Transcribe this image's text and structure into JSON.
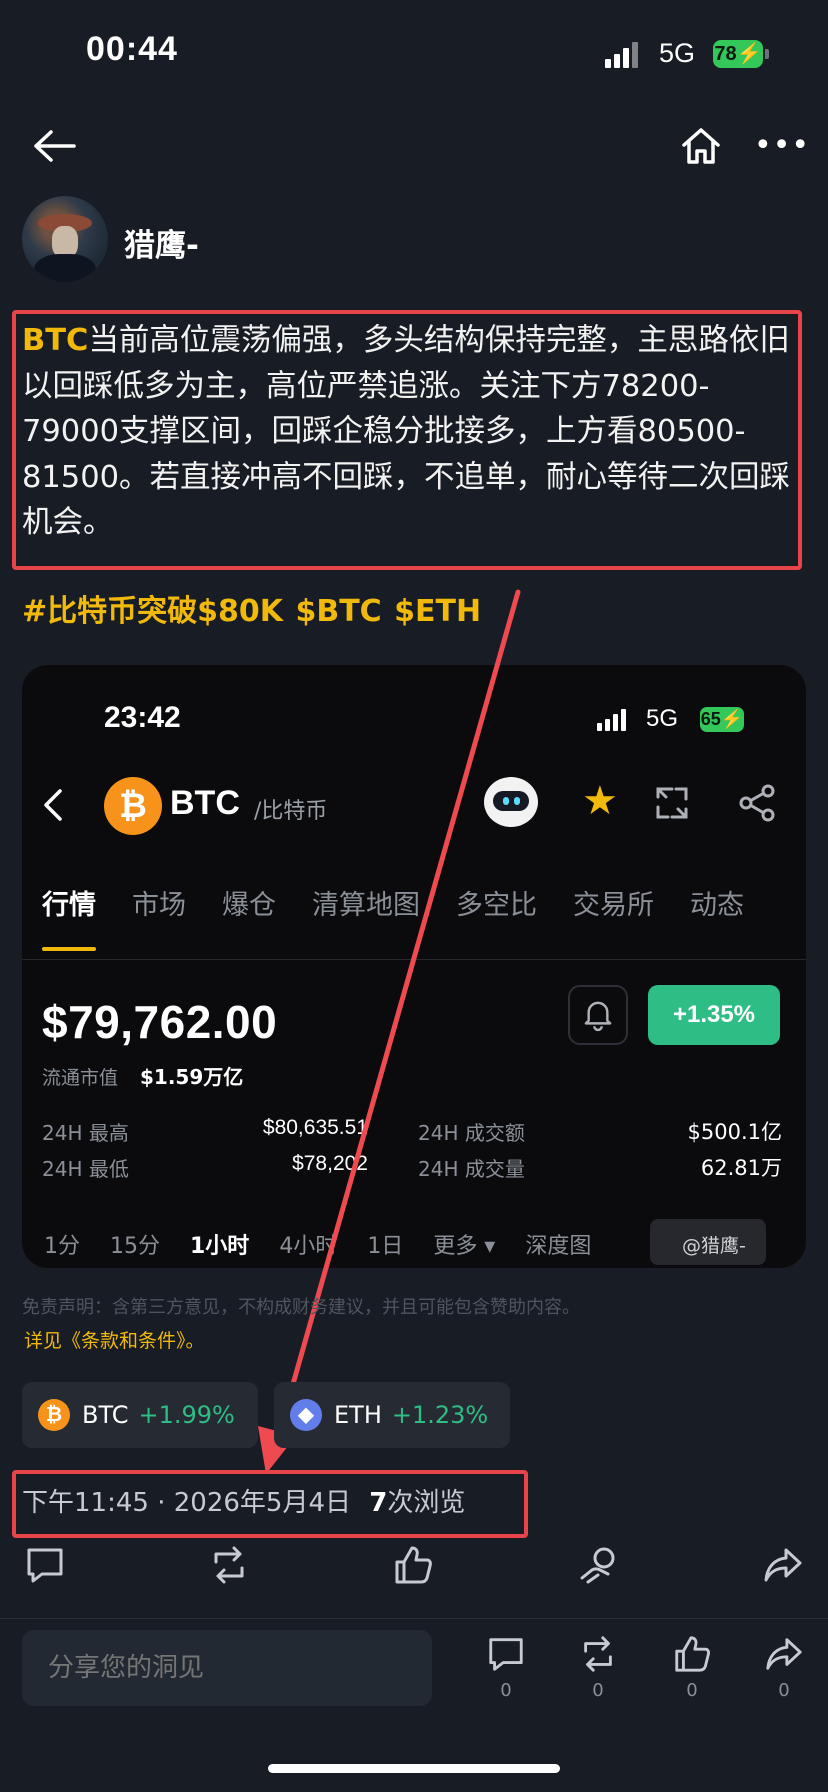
{
  "status_bar": {
    "time": "00:44",
    "network": "5G",
    "battery": "78"
  },
  "author": {
    "name": "猎鹰-"
  },
  "post": {
    "ticker": "BTC",
    "body": "当前高位震荡偏强，多头结构保持完整，主思路依旧以回踩低多为主，高位严禁追涨。关注下方78200-79000支撑区间，回踩企稳分批接多，上方看80500-81500。若直接冲高不回踩，不追单，耐心等待二次回踩机会。",
    "hashtags": "#比特币突破$80K $BTC $ETH"
  },
  "embedded": {
    "status_time": "23:42",
    "status_network": "5G",
    "status_battery": "65",
    "coin_glyph": "₿",
    "symbol": "BTC",
    "subname": "/比特币",
    "tabs": [
      "行情",
      "市场",
      "爆仓",
      "清算地图",
      "多空比",
      "交易所",
      "动态"
    ],
    "price": "$79,762.00",
    "change": "+1.35%",
    "market_cap_label": "流通市值",
    "market_cap_value": "$1.59万亿",
    "stats": {
      "high_label": "24H 最高",
      "high_value": "$80,635.51",
      "low_label": "24H 最低",
      "low_value": "$78,202",
      "turnover_label": "24H 成交额",
      "turnover_value": "$500.1亿",
      "volume_label": "24H 成交量",
      "volume_value": "62.81万"
    },
    "intervals": [
      "1分",
      "15分",
      "1小时",
      "4小时",
      "1日",
      "更多 ▾",
      "深度图"
    ],
    "active_interval": "1小时",
    "watermark": "@猎鹰-"
  },
  "disclaimer": "免责声明：含第三方意见，不构成财务建议，并且可能包含赞助内容。",
  "disclaimer_link": "详见《条款和条件》。",
  "coins": [
    {
      "symbol": "BTC",
      "change": "+1.99%",
      "color": "#f7931a"
    },
    {
      "symbol": "ETH",
      "change": "+1.23%",
      "color": "#627eea"
    }
  ],
  "meta": {
    "time": "下午11:45",
    "separator": "·",
    "date": "2026年5月4日",
    "views_count": "7",
    "views_label": "次浏览"
  },
  "share_placeholder": "分享您的洞见",
  "bottom_counts": {
    "comment": "0",
    "repost": "0",
    "like": "0",
    "share": "0"
  },
  "colors": {
    "accent": "#f0b90b",
    "positive": "#2ebd85",
    "highlight_box": "#e8444a",
    "background": "#181c24"
  }
}
